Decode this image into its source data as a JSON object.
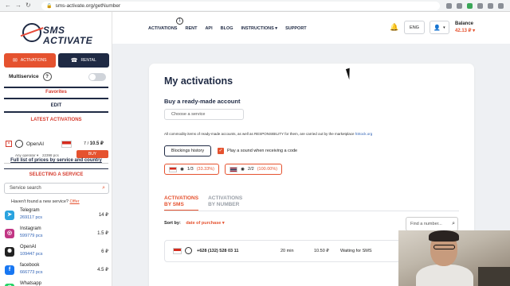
{
  "browser": {
    "url": "sms-activate.org/getNumber"
  },
  "logo": {
    "line1": "SMS",
    "line2": "ACTIVATE"
  },
  "sidebar": {
    "tabs": [
      {
        "label": "Activations",
        "active": true
      },
      {
        "label": "Rental",
        "active": false
      }
    ],
    "multiservice_label": "Multiservice",
    "help_symbol": "?",
    "favorites_label": "Favorites",
    "edit_label": "EDIT",
    "latest_activations_label": "LATEST ACTIVATIONS",
    "latest_item": {
      "remove_symbol": "×",
      "service": "OpenAI",
      "price_prefix": "7 /",
      "price": "10.5 ₽",
      "operator": "Any operator ▾",
      "count": "22398 pcs",
      "buy_label": "BUY"
    },
    "full_list_label": "Full list of prices by service and country",
    "selecting_label": "SELECTING A SERVICE",
    "search_placeholder": "Service search",
    "not_found_text": "Haven't found a new service?",
    "offer_label": "Offer",
    "services": [
      {
        "name": "Telegram",
        "count": "269117 pcs",
        "price": "14 ₽",
        "icon": "telegram-icon",
        "color": "#2aa3df",
        "glyph": "➤"
      },
      {
        "name": "Instagram",
        "count": "599779 pcs",
        "price": "1.5 ₽",
        "icon": "instagram-icon",
        "color": "#c13584",
        "glyph": "◎"
      },
      {
        "name": "OpenAI",
        "count": "109447 pcs",
        "price": "6 ₽",
        "icon": "openai-icon",
        "color": "#222222",
        "glyph": "✺"
      },
      {
        "name": "facebook",
        "count": "666773 pcs",
        "price": "4.5 ₽",
        "icon": "facebook-icon",
        "color": "#1877f2",
        "glyph": "f"
      },
      {
        "name": "Whatsapp",
        "count": "",
        "price": "",
        "icon": "whatsapp-icon",
        "color": "#25d366",
        "glyph": "✆"
      }
    ]
  },
  "header": {
    "nav": [
      "ACTIVATIONS",
      "RENT",
      "API",
      "BLOG",
      "INSTRUCTIONS ▾",
      "SUPPORT"
    ],
    "notification_count": "1",
    "language": "ENG",
    "balance_label": "Balance",
    "balance_value": "42.13 ₽ ▾"
  },
  "main": {
    "title": "My activations",
    "buy_title": "Buy a ready-made account",
    "choose_placeholder": "Choose a service",
    "note_text": "All commodity items of ready-made accounts, as well as RESPONSIBILITY for them, are carried out by the marketplace",
    "note_link": "hStock.org",
    "blocklist_label": "Blockings history",
    "sound_label": "Play a sound when receiving a code",
    "chips": [
      {
        "ratio": "1/3",
        "pct": "(33.33%)"
      },
      {
        "ratio": "2/2",
        "pct": "(100.00%)"
      }
    ],
    "tabs": [
      {
        "label": "ACTIVATIONS\nBY SMS",
        "line1": "ACTIVATIONS",
        "line2": "BY SMS",
        "active": true
      },
      {
        "line1": "ACTIVATIONS",
        "line2": "BY NUMBER",
        "active": false
      }
    ],
    "sort_label": "Sort by:",
    "sort_value": "date of purchase ▾",
    "find_placeholder": "Find a number...",
    "activation": {
      "number": "+628 (132) 528 03 11",
      "time": "20 min",
      "price": "10.50 ₽",
      "status": "Waiting for SMS"
    }
  },
  "colors": {
    "accent": "#e5522f",
    "navy": "#1f2a44"
  }
}
